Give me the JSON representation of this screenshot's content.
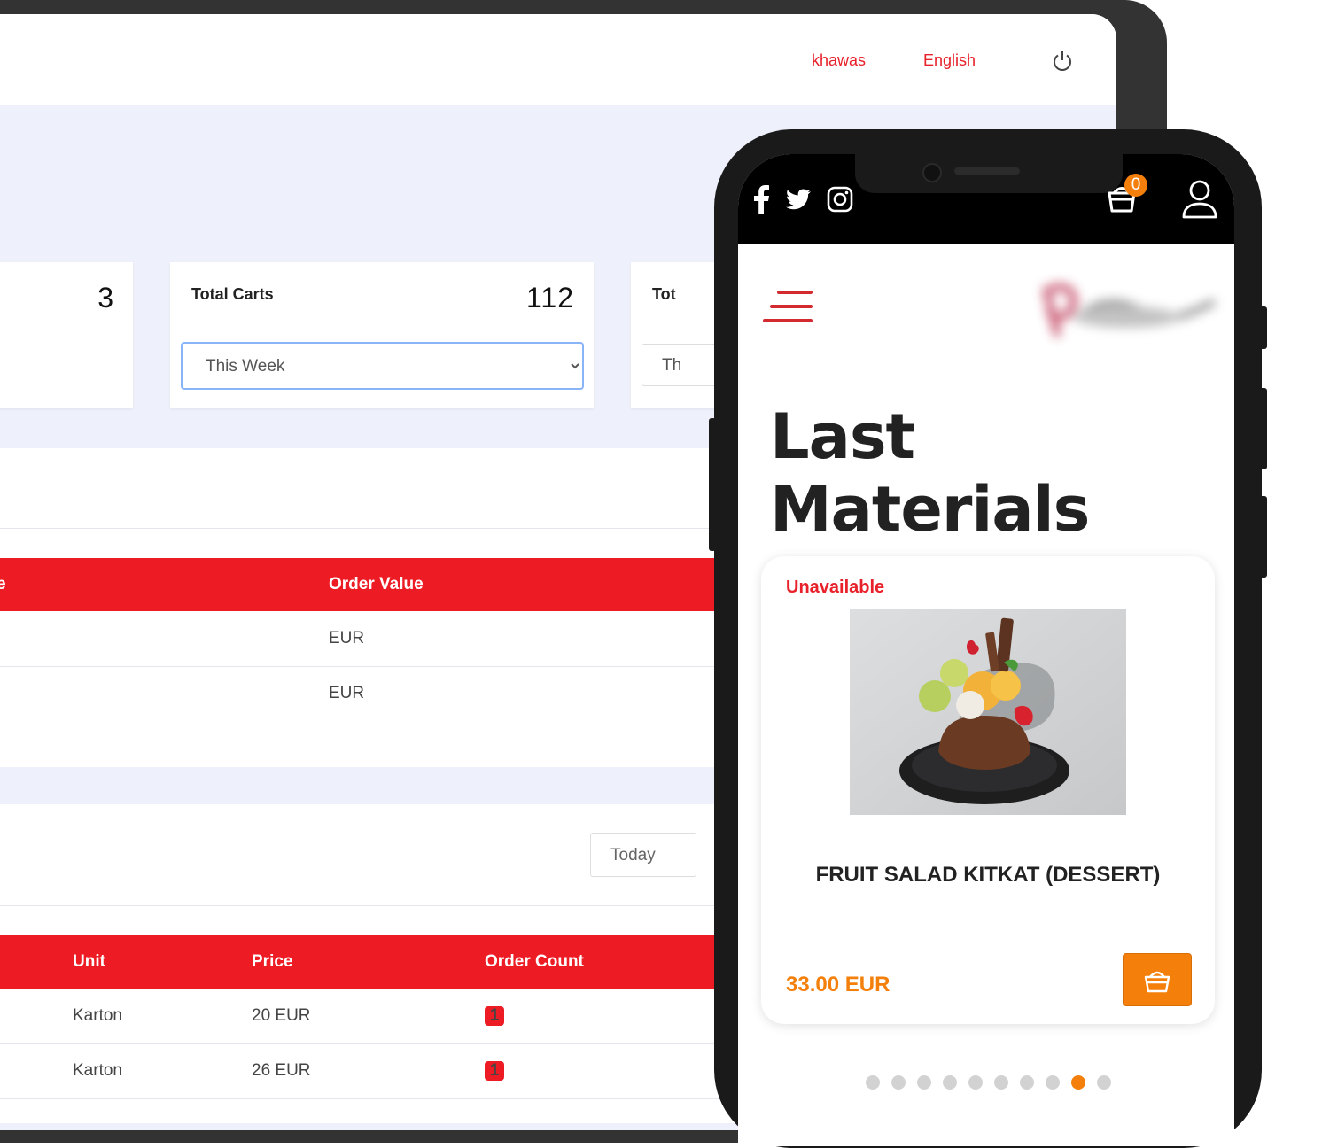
{
  "dashboard": {
    "header": {
      "user_name": "khawas",
      "language": "English"
    },
    "stats": {
      "card_left_value": "3",
      "total_carts": {
        "label": "Total Carts",
        "value": "112",
        "period": "This Week"
      },
      "third_card": {
        "label_partial": "Tot",
        "period_partial": "Th"
      }
    },
    "orders_table": {
      "headers": {
        "col_partial": "e",
        "order_value": "Order Value"
      },
      "rows": [
        {
          "order_value": "EUR"
        },
        {
          "order_value": "EUR"
        }
      ]
    },
    "products_table": {
      "filter": "Today",
      "headers": {
        "unit": "Unit",
        "price": "Price",
        "order_count": "Order Count"
      },
      "rows": [
        {
          "unit": "Karton",
          "price": "20 EUR",
          "order_count": "1"
        },
        {
          "unit": "Karton",
          "price": "26 EUR",
          "order_count": "1"
        }
      ]
    }
  },
  "phone": {
    "cart_count": "0",
    "heading": "Last Materials",
    "product": {
      "availability": "Unavailable",
      "name": "FRUIT SALAD KITKAT (DESSERT)",
      "price": "33.00 EUR"
    },
    "carousel": {
      "total": 10,
      "active": 9
    }
  },
  "colors": {
    "brand_red": "#ed1b24",
    "accent_orange": "#f47f0a"
  },
  "icons": [
    "power-icon",
    "facebook-icon",
    "twitter-icon",
    "instagram-icon",
    "cart-icon",
    "user-icon",
    "menu-icon"
  ]
}
